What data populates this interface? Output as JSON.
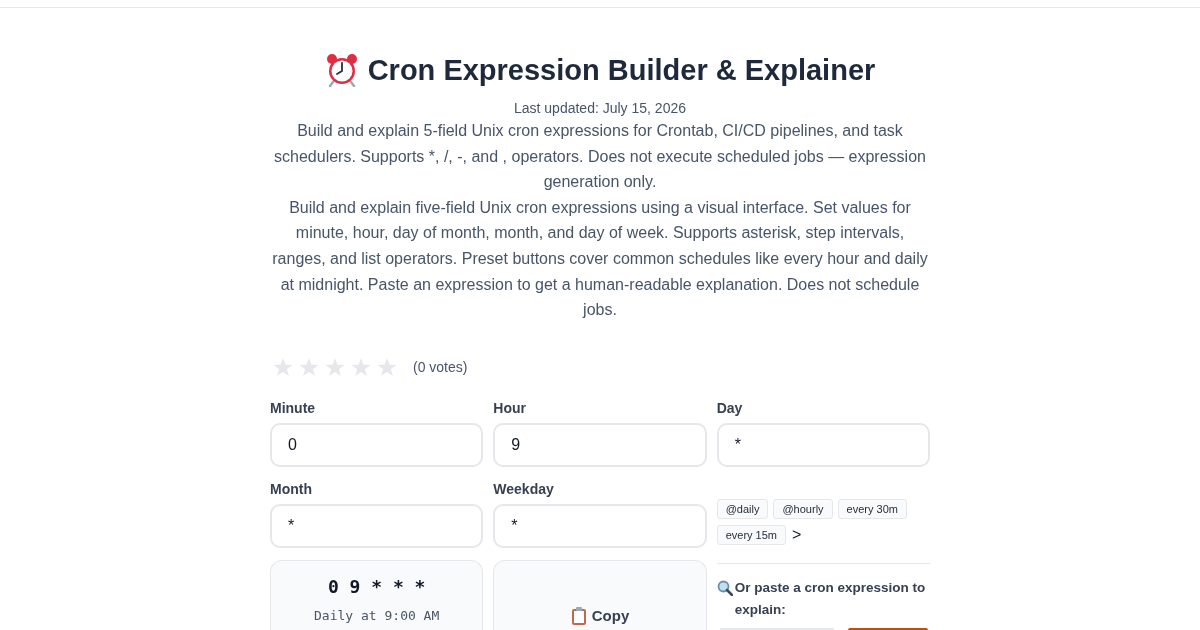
{
  "page": {
    "title": "Cron Expression Builder & Explainer",
    "last_updated": "Last updated: July 15, 2026",
    "description": [
      "Build and explain 5-field Unix cron expressions for Crontab, CI/CD pipelines, and task schedulers. Supports *, /, -, and , operators. Does not execute scheduled jobs — expression generation only.",
      "Build and explain five-field Unix cron expressions using a visual interface. Set values for minute, hour, day of month, month, and day of week. Supports asterisk, step intervals, ranges, and list operators. Preset buttons cover common schedules like every hour and daily at midnight. Paste an expression to get a human-readable explanation. Does not schedule jobs."
    ]
  },
  "rating": {
    "stars": 0,
    "votes": "(0 votes)"
  },
  "fields": [
    {
      "label": "Minute",
      "value": "0"
    },
    {
      "label": "Hour",
      "value": "9"
    },
    {
      "label": "Day",
      "value": "*"
    },
    {
      "label": "Month",
      "value": "*"
    },
    {
      "label": "Weekday",
      "value": "*"
    }
  ],
  "presets": {
    "items": [
      "@daily",
      "@hourly",
      "every 30m",
      "every 15m"
    ],
    "more": ">"
  },
  "result": {
    "expression": "0 9 * * *",
    "explanation": "Daily at 9:00 AM"
  },
  "copy_button": {
    "label": "Copy"
  },
  "explain": {
    "heading": "Or paste a cron expression to explain:"
  }
}
